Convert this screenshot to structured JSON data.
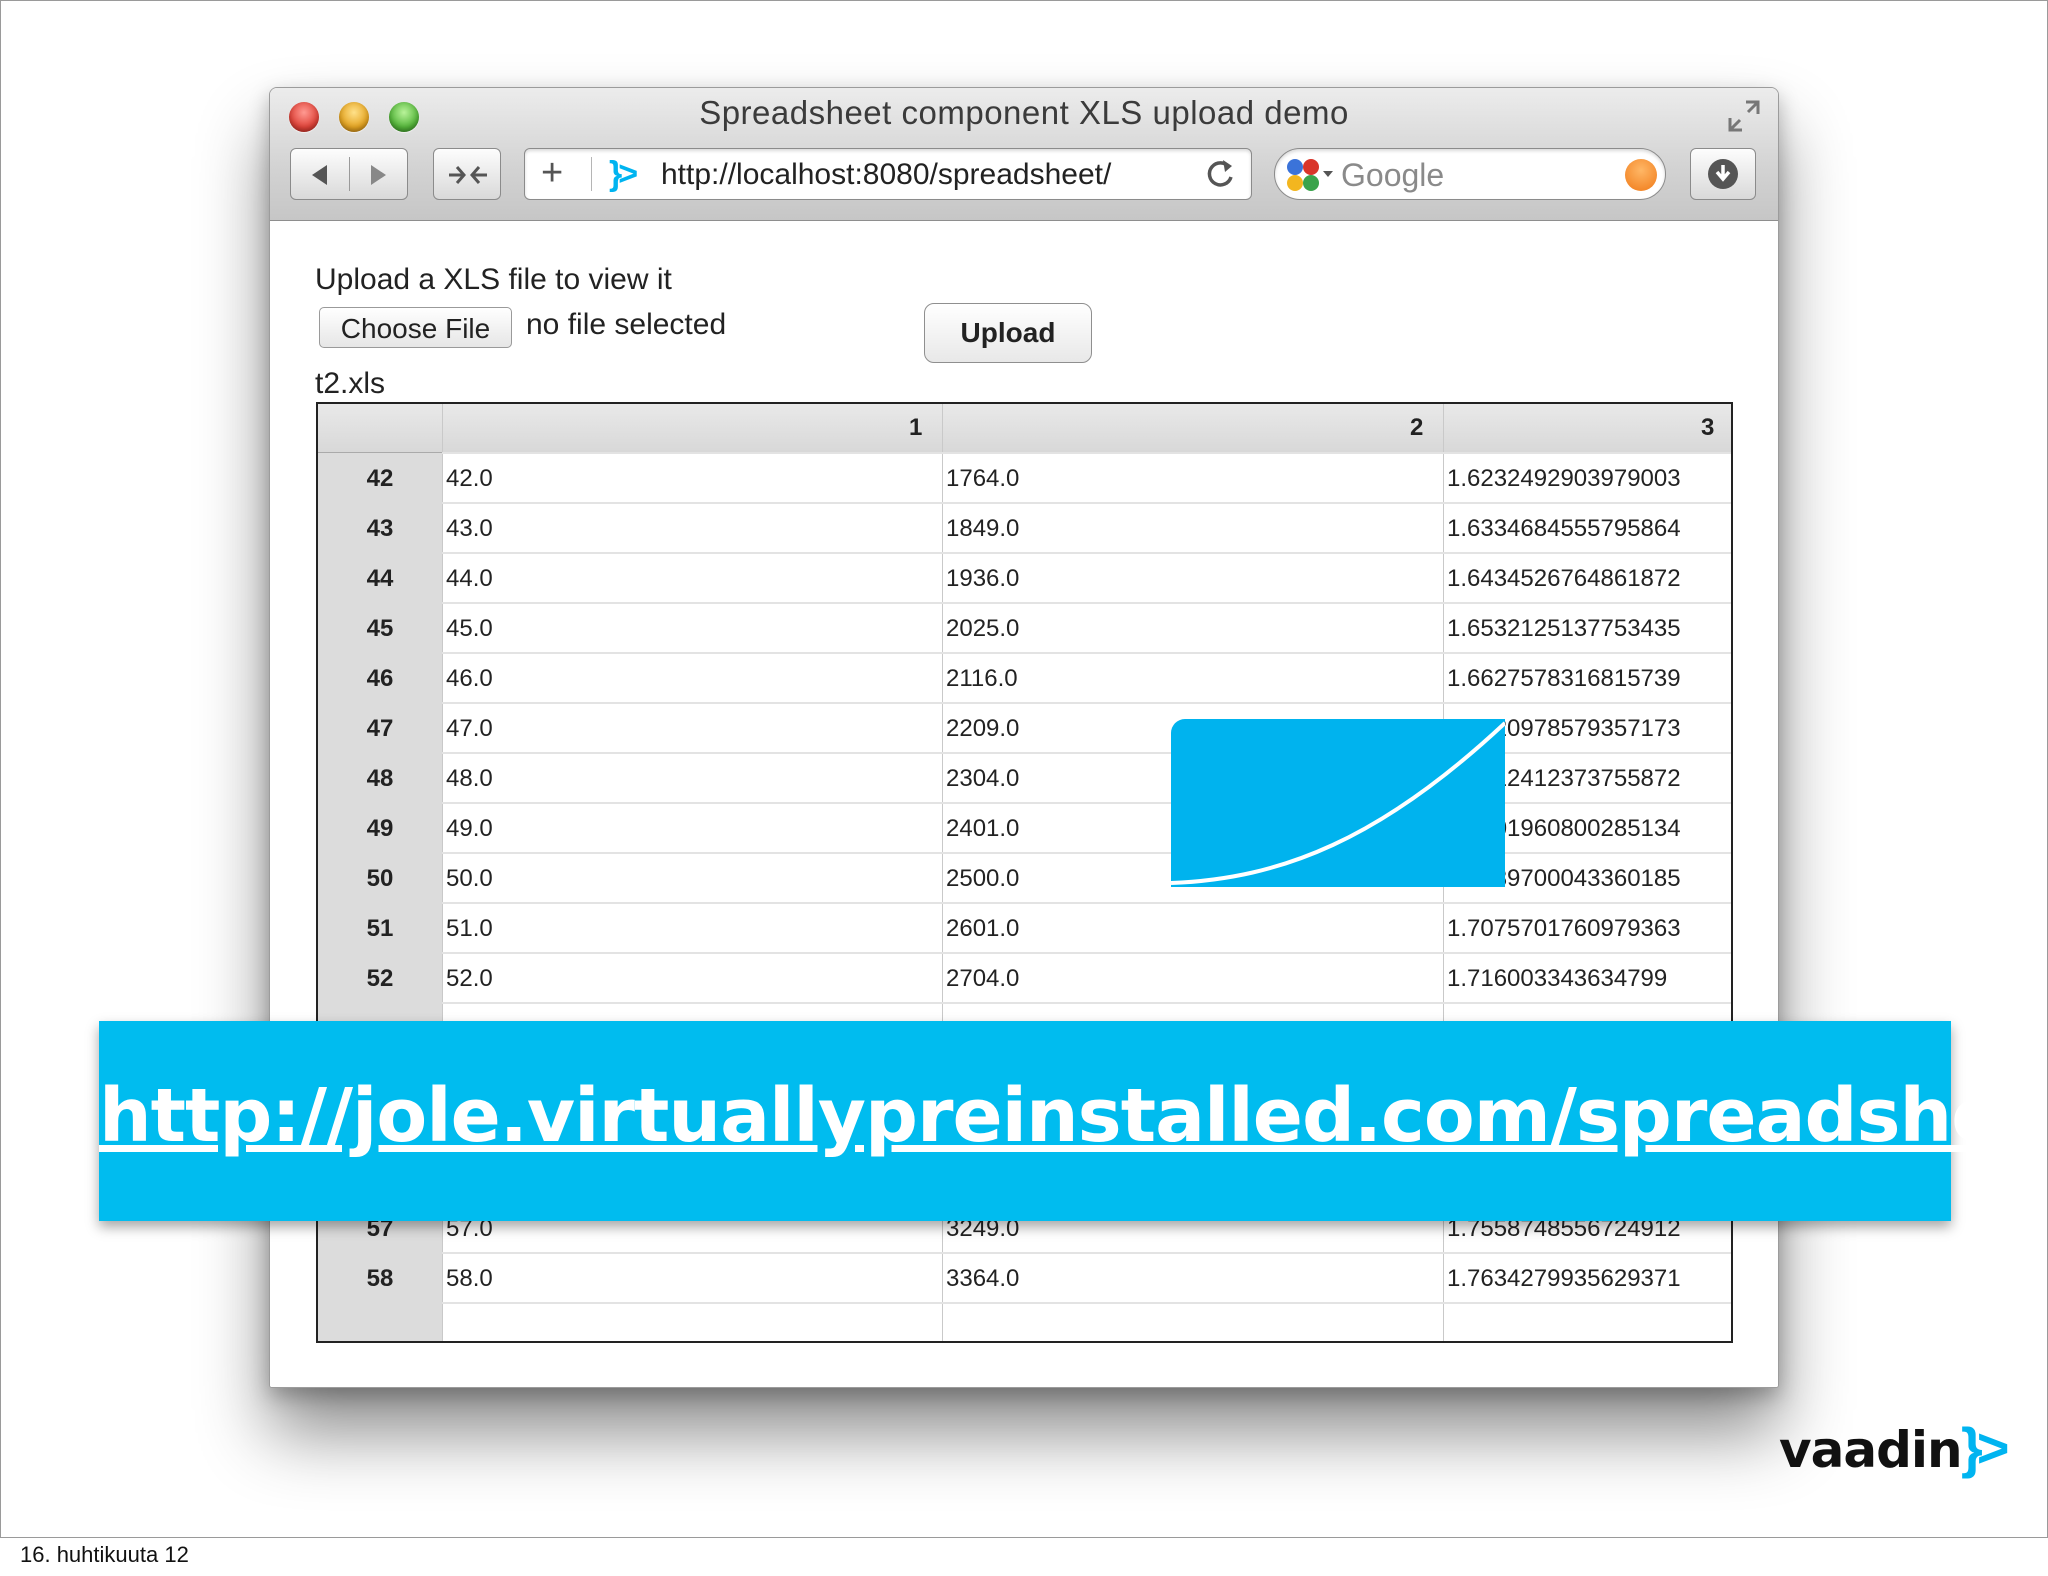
{
  "window": {
    "title": "Spreadsheet component XLS upload demo",
    "url": "http://localhost:8080/spreadsheet/",
    "url_plus": "+",
    "url_logo": "}>",
    "search_placeholder": "Google"
  },
  "upload": {
    "label": "Upload a XLS file to view it",
    "choose_file": "Choose File",
    "no_file": "no file selected",
    "upload_button": "Upload",
    "filename": "t2.xls"
  },
  "sheet": {
    "columns": [
      "1",
      "2",
      "3"
    ],
    "rows": [
      {
        "n": "42",
        "c1": "42.0",
        "c2": "1764.0",
        "c3": "1.6232492903979003"
      },
      {
        "n": "43",
        "c1": "43.0",
        "c2": "1849.0",
        "c3": "1.6334684555795864"
      },
      {
        "n": "44",
        "c1": "44.0",
        "c2": "1936.0",
        "c3": "1.6434526764861872"
      },
      {
        "n": "45",
        "c1": "45.0",
        "c2": "2025.0",
        "c3": "1.6532125137753435"
      },
      {
        "n": "46",
        "c1": "46.0",
        "c2": "2116.0",
        "c3": "1.6627578316815739"
      },
      {
        "n": "47",
        "c1": "47.0",
        "c2": "2209.0",
        "c3": "1.6720978579357173"
      },
      {
        "n": "48",
        "c1": "48.0",
        "c2": "2304.0",
        "c3": "1.6812412373755872"
      },
      {
        "n": "49",
        "c1": "49.0",
        "c2": "2401.0",
        "c3": "1.6901960800285134"
      },
      {
        "n": "50",
        "c1": "50.0",
        "c2": "2500.0",
        "c3": "1.6989700043360185"
      },
      {
        "n": "51",
        "c1": "51.0",
        "c2": "2601.0",
        "c3": "1.7075701760979363"
      },
      {
        "n": "52",
        "c1": "52.0",
        "c2": "2704.0",
        "c3": "1.716003343634799"
      },
      {
        "n": "57",
        "c1": "57.0",
        "c2": "3249.0",
        "c3": "1.7558748556724912"
      },
      {
        "n": "58",
        "c1": "58.0",
        "c2": "3364.0",
        "c3": "1.7634279935629371"
      }
    ]
  },
  "banner": {
    "link": "http://jole.virtuallypreinstalled.com/spreadsheet"
  },
  "brand": {
    "name": "vaadin",
    "mark": "}>"
  },
  "footer": {
    "date": "16. huhtikuuta 12"
  },
  "colors": {
    "accent": "#00bcef",
    "titlebar": "#d6d6d6"
  }
}
